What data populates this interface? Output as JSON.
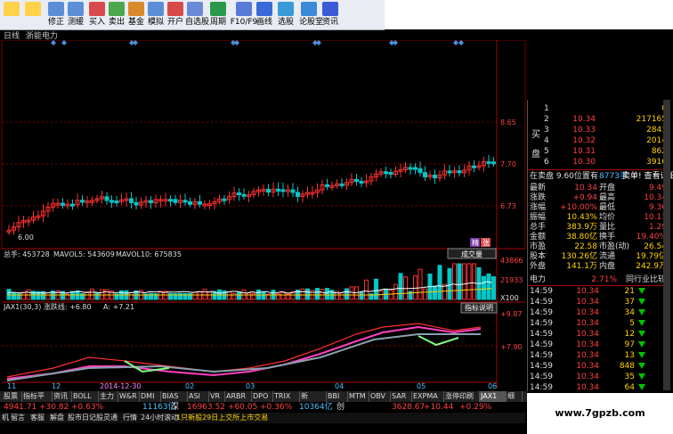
{
  "toolbar": {
    "buttons": [
      {
        "label": "",
        "icon": "back-icon"
      },
      {
        "label": "",
        "icon": "forward-icon"
      },
      {
        "label": "修正",
        "icon": "revise-icon"
      },
      {
        "label": "测缓",
        "icon": "cache-icon"
      },
      {
        "label": "买入",
        "icon": "buy-icon"
      },
      {
        "label": "卖出",
        "icon": "sell-icon"
      },
      {
        "label": "基金",
        "icon": "fund-icon"
      },
      {
        "label": "模拟",
        "icon": "simulate-icon"
      },
      {
        "label": "开户",
        "icon": "account-icon"
      },
      {
        "label": "自选股",
        "icon": "watchlist-icon"
      },
      {
        "label": "周期",
        "icon": "period-icon"
      },
      {
        "label": "F10/F9",
        "icon": "f10-icon"
      },
      {
        "label": "画线",
        "icon": "draw-icon"
      },
      {
        "label": "选股",
        "icon": "select-icon"
      },
      {
        "label": "论股堂",
        "icon": "forum-icon"
      },
      {
        "label": "资讯",
        "icon": "news-icon"
      }
    ]
  },
  "chart_head": {
    "period": "日线",
    "name": "浙能电力"
  },
  "price_axis": [
    "8.65",
    "7.70",
    "6.73"
  ],
  "low_label": "6.00",
  "volume": {
    "head": [
      "总手: 453728",
      "MAVOL5: 543609",
      "MAVOL10: 675835"
    ],
    "axis": [
      "43866",
      "21933",
      "X100"
    ],
    "dropdown": "成交量",
    "badge1": "精",
    "badge2": "张"
  },
  "indicator": {
    "head": [
      "JAX1(30,3) 涨跌线: +6.80",
      "A: +7.21"
    ],
    "explain": "指标说明",
    "axis": [
      "+9.87",
      "+7.90"
    ]
  },
  "xaxis": [
    "11",
    "12",
    "2014-12-30",
    "02",
    "03",
    "04",
    "05",
    "06"
  ],
  "order_book": {
    "sell": [
      {
        "idx": "1",
        "price": "",
        "vol": "0"
      },
      {
        "idx": "2",
        "price": "10.34",
        "vol": "217165"
      },
      {
        "idx": "3",
        "price": "10.33",
        "vol": "2841"
      },
      {
        "idx": "4",
        "price": "10.32",
        "vol": "2014"
      },
      {
        "idx": "5",
        "price": "10.31",
        "vol": "862"
      },
      {
        "idx": "6",
        "price": "10.30",
        "vol": "3916"
      }
    ],
    "side_label_1": "买",
    "side_label_2": "盘"
  },
  "stats_head": {
    "a": "在卖盘 9.60位置有",
    "b": "8773手",
    "c": "卖单! 查看详细"
  },
  "stats": [
    {
      "k1": "最新",
      "v1": "10.34",
      "k2": "开盘",
      "v2": "9.49"
    },
    {
      "k1": "涨跌",
      "v1": "+0.94",
      "k2": "最高",
      "v2": "10.34"
    },
    {
      "k1": "涨幅",
      "v1": "+10.00%",
      "k2": "最低",
      "v2": "9.36"
    },
    {
      "k1": "振幅",
      "v1": "10.43%",
      "k2": "均价",
      "v2": "10.13"
    },
    {
      "k1": "总手",
      "v1": "383.9万",
      "k2": "量比",
      "v2": "1.29"
    },
    {
      "k1": "金额",
      "v1": "38.80亿",
      "k2": "换手",
      "v2": "19.40%"
    },
    {
      "k1": "市盈",
      "v1": "22.58",
      "k2": "市盈(动)",
      "v2": "26.54"
    },
    {
      "k1": "股本",
      "v1": "130.26亿",
      "k2": "流通",
      "v2": "19.79亿"
    },
    {
      "k1": "外盘",
      "v1": "141.1万",
      "k2": "内盘",
      "v2": "242.9万"
    }
  ],
  "industry": {
    "name": "电力",
    "pct": "2.71%",
    "compare": "同行业比较"
  },
  "ticks": [
    {
      "time": "14:59",
      "price": "10.34",
      "vol": "21"
    },
    {
      "time": "14:59",
      "price": "10.34",
      "vol": "37"
    },
    {
      "time": "14:59",
      "price": "10.34",
      "vol": "34"
    },
    {
      "time": "14:59",
      "price": "10.34",
      "vol": "5"
    },
    {
      "time": "14:59",
      "price": "10.34",
      "vol": "12"
    },
    {
      "time": "14:59",
      "price": "10.34",
      "vol": "97"
    },
    {
      "time": "14:59",
      "price": "10.34",
      "vol": "13"
    },
    {
      "time": "14:59",
      "price": "10.34",
      "vol": "848"
    },
    {
      "time": "14:59",
      "price": "10.34",
      "vol": "35"
    },
    {
      "time": "14:59",
      "price": "10.34",
      "vol": "64"
    }
  ],
  "tabs": [
    "股票",
    "指标平台",
    "资讯",
    "BOLL",
    "主力",
    "W&R",
    "DMI",
    "BIAS",
    "ASI",
    "VR",
    "ARBR",
    "DPO",
    "TRIX",
    "新DMA",
    "BBI",
    "MTM",
    "OBV",
    "SAR",
    "EXPMA",
    "涨停印刷胶",
    "JAX1",
    "细"
  ],
  "index_bar": [
    {
      "text": "4941.71",
      "color": "#ff4040"
    },
    {
      "text": "+30.82",
      "color": "#ff4040"
    },
    {
      "text": "+0.63%",
      "color": "#ff4040"
    },
    {
      "text": "11163亿",
      "color": "#4ac0ff"
    },
    {
      "text": "深",
      "color": "#ddd"
    },
    {
      "text": "16963.52",
      "color": "#ff4040"
    },
    {
      "text": "+60.05",
      "color": "#ff4040"
    },
    {
      "text": "+0.36%",
      "color": "#ff4040"
    },
    {
      "text": "10364亿",
      "color": "#4ac0ff"
    },
    {
      "text": "创",
      "color": "#ddd"
    },
    {
      "text": "3628.67",
      "color": "#ff4040"
    },
    {
      "text": "+10.44",
      "color": "#ff4040"
    },
    {
      "text": "+0.29%",
      "color": "#ff4040"
    }
  ],
  "status_bar": [
    "机",
    "留言",
    "客服",
    "解盘",
    "股市日记",
    "股灵通",
    "行情",
    "24小时滚动",
    "1只新股29日上交所上市交易"
  ],
  "watermark": "www.7gpzb.com",
  "colors": {
    "up": "#ff3030",
    "down": "#00c8c8",
    "flat": "#dddddd",
    "price_yellow": "#ffd400",
    "green_arrow": "#00c000"
  }
}
